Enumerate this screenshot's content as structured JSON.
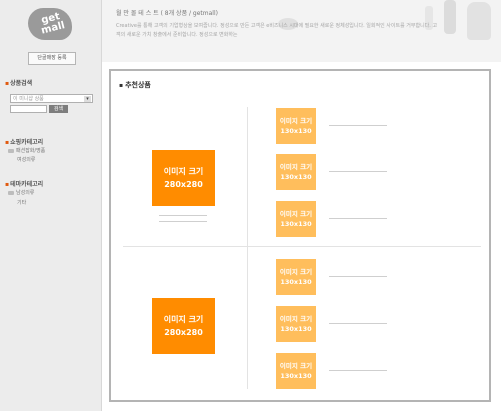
{
  "sidebar": {
    "logo_text_line1": "get",
    "logo_text_line2": "mall",
    "register_button": "단골매장 등록",
    "product_search": {
      "title": "상품검색",
      "select_placeholder": "이 미니샵 상품",
      "search_button": "검색"
    },
    "shopping_category": {
      "title": "쇼핑카테고리",
      "items": [
        "패션잡화/명품",
        "여성의류"
      ]
    },
    "theme_category": {
      "title": "테마카테고리",
      "items": [
        "남성의류",
        "기타"
      ]
    }
  },
  "header": {
    "title": "월 만 몰 테 스 트 ( 8개 상품 / getmall)",
    "description": "Creative를 통해 고객의 기업형상을 보여줍니다. 정성으로 만든 고객은 e비즈니스 시대에 필요한 새로운 정체성입니다. 일회적인 사이트를 거부합니다. 고객의 새로운 가치 창출에서 준비합니다. 정성으로 변화하는"
  },
  "main": {
    "section_title": "추천상품",
    "big_products": [
      {
        "label": "이미지 크기",
        "size": "280x280"
      },
      {
        "label": "이미지 크기",
        "size": "280x280"
      }
    ],
    "small_products": [
      {
        "label": "이미지 크기",
        "size": "130x130"
      },
      {
        "label": "이미지 크기",
        "size": "130x130"
      },
      {
        "label": "이미지 크기",
        "size": "130x130"
      },
      {
        "label": "이미지 크기",
        "size": "130x130"
      },
      {
        "label": "이미지 크기",
        "size": "130x130"
      },
      {
        "label": "이미지 크기",
        "size": "130x130"
      }
    ]
  },
  "colors": {
    "big_placeholder": "#ff8c00",
    "small_placeholder": "#ffbe5c",
    "accent": "#e05a10"
  }
}
